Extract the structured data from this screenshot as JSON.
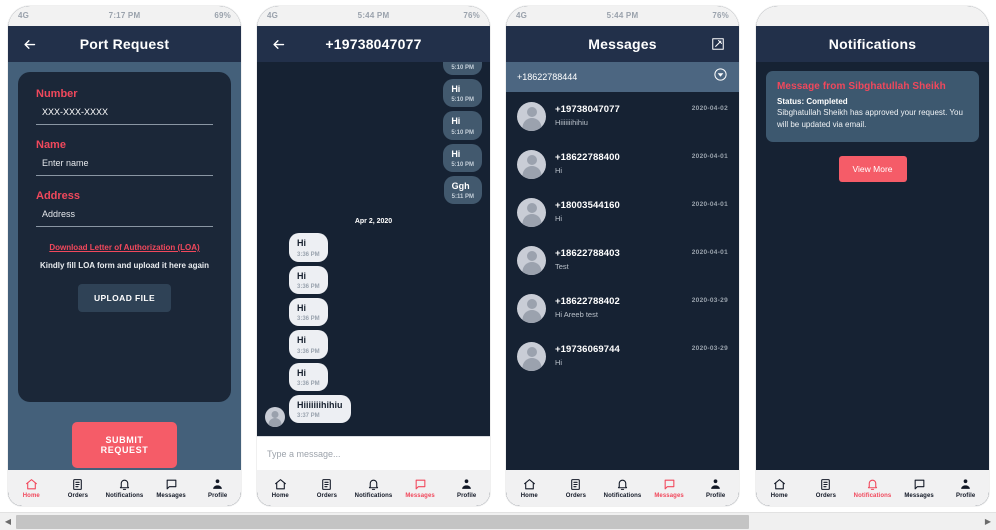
{
  "nav": {
    "items": [
      {
        "label": "Home",
        "icon": "home-icon"
      },
      {
        "label": "Orders",
        "icon": "orders-icon"
      },
      {
        "label": "Notifications",
        "icon": "bell-icon"
      },
      {
        "label": "Messages",
        "icon": "chat-icon"
      },
      {
        "label": "Profile",
        "icon": "profile-icon"
      }
    ]
  },
  "colors": {
    "accent": "#f1485c",
    "submit": "#f55c68",
    "appbar": "#22304a",
    "screen_dark": "#162233",
    "page_slate": "#44607a",
    "bubble_out": "#42596e",
    "bubble_in": "#edeff3"
  },
  "phone1": {
    "status": {
      "left": "4G",
      "mid": "7:17 PM",
      "right": "69%"
    },
    "title": "Port Request",
    "back_icon": "back-arrow-icon",
    "fields": [
      {
        "label": "Number",
        "value": "XXX-XXX-XXXX",
        "placeholder": "XXX-XXX-XXXX"
      },
      {
        "label": "Name",
        "value": "Enter name",
        "placeholder": "Enter name"
      },
      {
        "label": "Address",
        "value": "Address",
        "placeholder": "Address"
      }
    ],
    "loa_link": "Download Letter of Authorization (LOA)",
    "loa_note": "Kindly fill LOA form and upload it here again",
    "upload_label": "UPLOAD FILE",
    "submit_label": "SUBMIT REQUEST",
    "active_nav": "Home"
  },
  "phone2": {
    "status": {
      "left": "4G",
      "mid": "5:44 PM",
      "right": "76%"
    },
    "title": "+19738047077",
    "back_icon": "back-arrow-icon",
    "clipped_top_time": "5:10 PM",
    "outgoing": [
      {
        "text": "Hi",
        "time": "5:10 PM"
      },
      {
        "text": "Hi",
        "time": "5:10 PM"
      },
      {
        "text": "Hi",
        "time": "5:10 PM"
      },
      {
        "text": "Ggh",
        "time": "5:11 PM"
      }
    ],
    "daystamp": "Apr 2, 2020",
    "incoming": [
      {
        "text": "Hi",
        "time": "3:36 PM"
      },
      {
        "text": "Hi",
        "time": "3:36 PM"
      },
      {
        "text": "Hi",
        "time": "3:36 PM"
      },
      {
        "text": "Hi",
        "time": "3:36 PM"
      },
      {
        "text": "Hi",
        "time": "3:36 PM"
      },
      {
        "text": "Hiiiiiiihihiu",
        "time": "3:37 PM"
      }
    ],
    "composer_placeholder": "Type a message...",
    "active_nav": "Messages"
  },
  "phone3": {
    "status": {
      "left": "4G",
      "mid": "5:44 PM",
      "right": "76%"
    },
    "title": "Messages",
    "compose_icon": "compose-icon",
    "selected_number": "+18622788444",
    "dropdown_icon": "chevron-down-circle-icon",
    "rows": [
      {
        "number": "+19738047077",
        "preview": "Hiiiiiiihihiu",
        "date": "2020-04-02"
      },
      {
        "number": "+18622788400",
        "preview": "Hi",
        "date": "2020-04-01"
      },
      {
        "number": "+18003544160",
        "preview": "Hi",
        "date": "2020-04-01"
      },
      {
        "number": "+18622788403",
        "preview": "Test",
        "date": "2020-04-01"
      },
      {
        "number": "+18622788402",
        "preview": "Hi Areeb test",
        "date": "2020-03-29"
      },
      {
        "number": "+19736069744",
        "preview": "Hi",
        "date": "2020-03-29"
      }
    ],
    "active_nav": "Messages"
  },
  "phone4": {
    "status": {
      "left": "",
      "mid": "",
      "right": ""
    },
    "title": "Notifications",
    "card": {
      "title": "Message from Sibghatullah Sheikh",
      "status": "Status: Completed",
      "body": "Sibghatullah Sheikh has approved your request. You will be updated via email."
    },
    "view_more_label": "View More",
    "active_nav": "Notifications"
  },
  "scrollbar": {
    "left_arrow": "scroll-left-arrow-icon",
    "right_arrow": "scroll-right-arrow-icon"
  }
}
